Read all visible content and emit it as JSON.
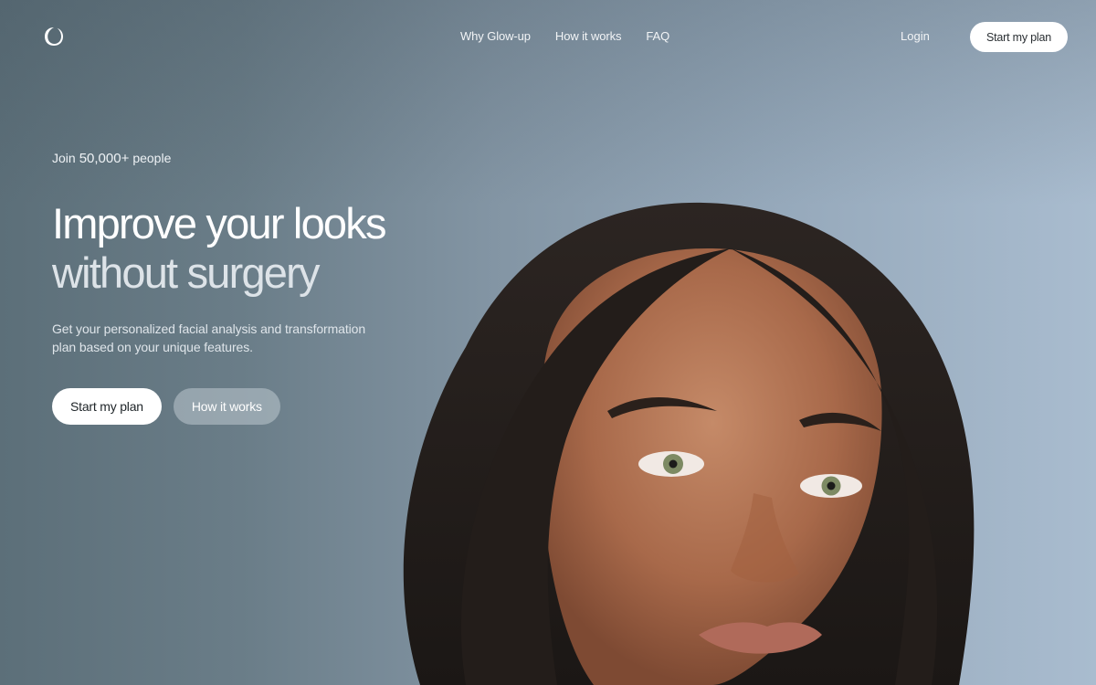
{
  "nav": {
    "logo_icon": "brand-logo-icon",
    "links": [
      {
        "label": "Why Glow-up"
      },
      {
        "label": "How it works"
      },
      {
        "label": "FAQ"
      }
    ],
    "login_label": "Login",
    "cta_label": "Start my plan"
  },
  "hero": {
    "social_prefix": "Join",
    "social_count": "50,000+",
    "social_suffix": "people",
    "headline_line1": "Improve your looks",
    "headline_line2": "without surgery",
    "subheadline": "Get your personalized facial analysis and transformation plan based on your unique features.",
    "primary_cta": "Start my plan",
    "secondary_cta": "How it works"
  },
  "colors": {
    "background_left": "#5c6f79",
    "background_right": "#a9bccf",
    "button_white": "#ffffff",
    "button_secondary": "#a7b3bc"
  }
}
